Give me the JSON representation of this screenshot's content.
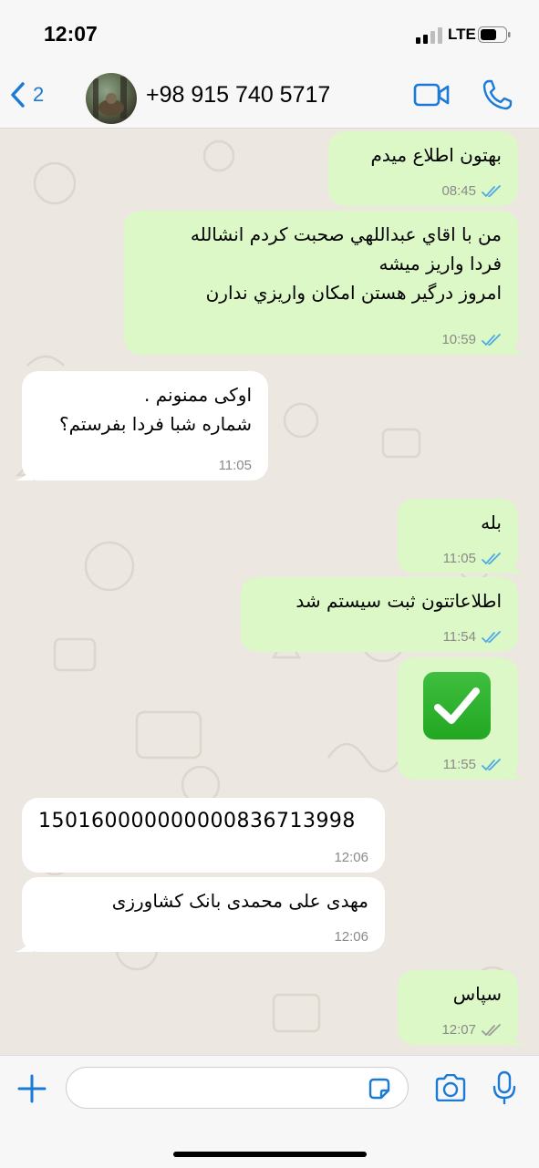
{
  "status_bar": {
    "time": "12:07",
    "network": "LTE"
  },
  "header": {
    "back_count": "2",
    "contact_name": "+98 915 740 5717"
  },
  "messages": [
    {
      "direction": "out",
      "text": "بهتون اطلاع میدم",
      "time": "08:45",
      "read": true
    },
    {
      "direction": "out",
      "text": "من با اقاي عبداللهي صحبت كردم انشالله\nفردا واريز ميشه\nامروز درگير هستن امكان واريزي ندارن",
      "time": "10:59",
      "read": true
    },
    {
      "direction": "in",
      "text": "اوکی ممنونم .\nشماره شبا فردا بفرستم؟",
      "time": "11:05"
    },
    {
      "direction": "out",
      "text": "بله",
      "time": "11:05",
      "read": true
    },
    {
      "direction": "out",
      "text": "اطلاعاتتون ثبت سيستم شد",
      "time": "11:54",
      "read": true
    },
    {
      "direction": "out",
      "emoji": "check-mark-button",
      "time": "11:55",
      "read": true
    },
    {
      "direction": "in",
      "text": "150160000000000836713998",
      "time": "12:06"
    },
    {
      "direction": "in",
      "text": "مهدی علی محمدی بانک کشاورزی",
      "time": "12:06"
    },
    {
      "direction": "out",
      "text": "سپاس",
      "time": "12:07",
      "read": false
    }
  ],
  "colors": {
    "accent": "#1a7bd6",
    "outgoing_bubble": "#dcf8c6",
    "incoming_bubble": "#ffffff",
    "chat_bg": "#ece7e0",
    "read_tick": "#4fa9e6"
  }
}
